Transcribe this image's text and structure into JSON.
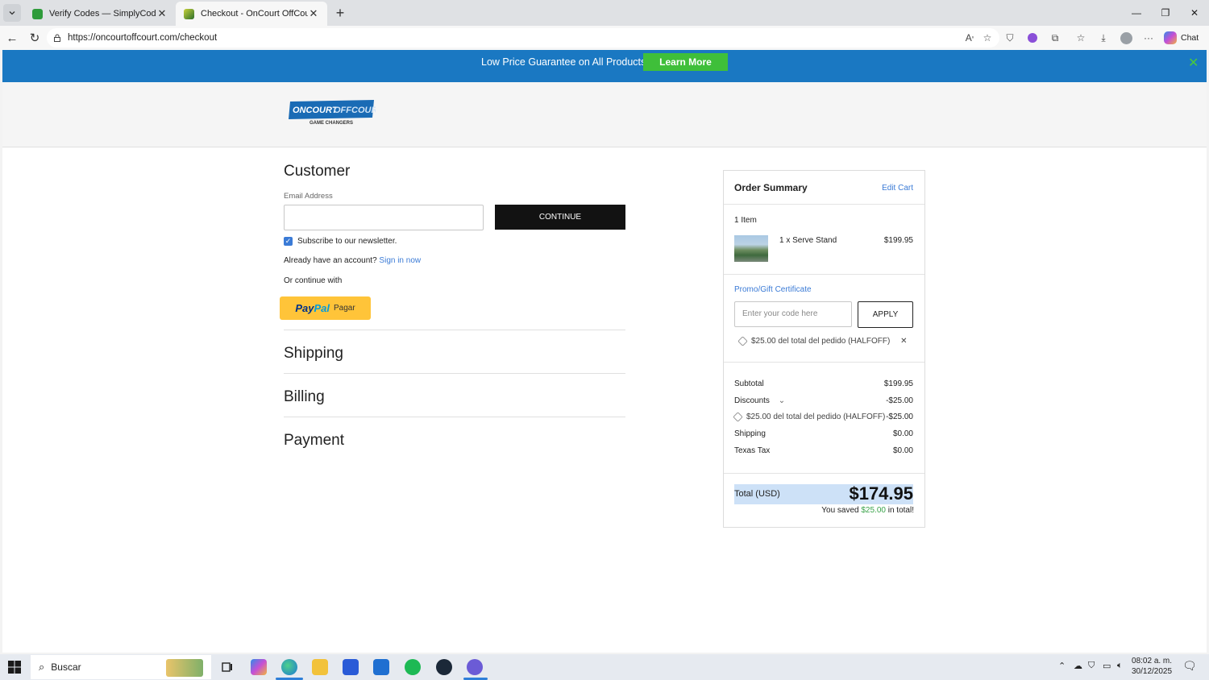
{
  "browser": {
    "tabs": [
      {
        "title": "Verify Codes — SimplyCodes",
        "favicon": "simplycodes-icon"
      },
      {
        "title": "Checkout - OnCourt OffCourt",
        "favicon": "oncourt-icon"
      }
    ],
    "url": "https://oncourtoffcourt.com/checkout",
    "chat_label": "Chat"
  },
  "promo": {
    "text": "Low Price Guarantee on All Products!",
    "button": "Learn More",
    "colors": {
      "banner": "#1a78c2",
      "button": "#3fbf3a"
    }
  },
  "logo": {
    "line1": "ONCOURT OFFCOURT",
    "line2": "GAME CHANGERS"
  },
  "customer": {
    "heading": "Customer",
    "email_label": "Email Address",
    "email_value": "",
    "continue_button": "CONTINUE",
    "newsletter_label": "Subscribe to our newsletter.",
    "newsletter_checked": true,
    "account_prompt": "Already have an account?",
    "sign_in_link": "Sign in now",
    "or_continue": "Or continue with",
    "paypal_brand_a": "Pay",
    "paypal_brand_b": "Pal",
    "paypal_action": "Pagar"
  },
  "sections": [
    "Shipping",
    "Billing",
    "Payment"
  ],
  "summary": {
    "title": "Order Summary",
    "edit_cart": "Edit Cart",
    "item_count": "1 Item",
    "item": {
      "name": "1 x Serve Stand",
      "price": "$199.95"
    },
    "promo_label": "Promo/Gift Certificate",
    "promo_placeholder": "Enter your code here",
    "apply_button": "APPLY",
    "applied_code": "$25.00 del total del pedido (HALFOFF)",
    "subtotal_label": "Subtotal",
    "subtotal": "$199.95",
    "discounts_label": "Discounts",
    "discounts": "-$25.00",
    "discount_detail": "$25.00 del total del pedido (HALFOFF)",
    "discount_detail_value": "-$25.00",
    "shipping_label": "Shipping",
    "shipping": "$0.00",
    "tax_label": "Texas Tax",
    "tax": "$0.00",
    "total_label": "Total (USD)",
    "total": "$174.95",
    "saved_prefix": "You saved",
    "saved_amount": "$25.00",
    "saved_suffix": "in total!"
  },
  "taskbar": {
    "search_placeholder": "Buscar",
    "time": "08:02 a. m.",
    "date": "30/12/2025"
  }
}
